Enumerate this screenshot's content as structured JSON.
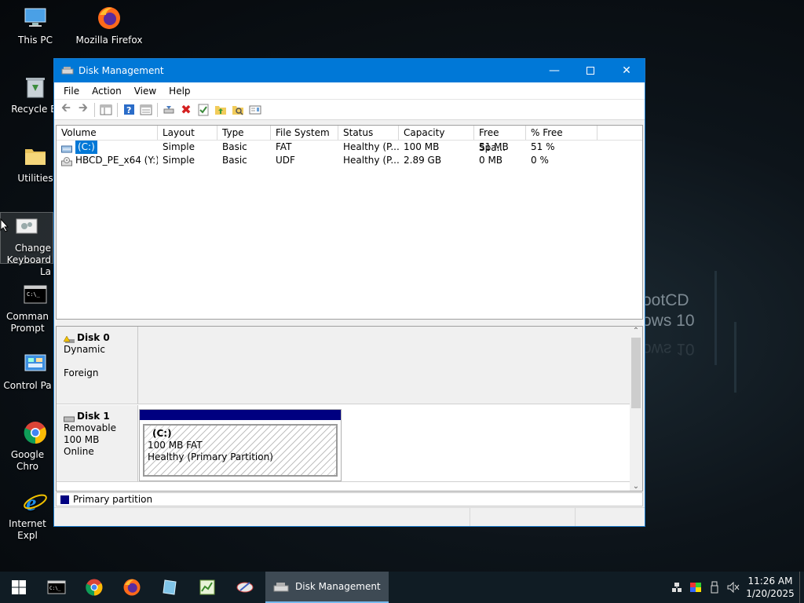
{
  "desktop": {
    "icons": [
      {
        "label": "This PC"
      },
      {
        "label": "Mozilla Firefox"
      },
      {
        "label": "Recycle Bi"
      },
      {
        "label": "Utilities"
      },
      {
        "label": "Change Keyboard La"
      },
      {
        "label": "Comman Prompt"
      },
      {
        "label": "Control Pa"
      },
      {
        "label": "Google Chro"
      },
      {
        "label": "Internet Expl"
      }
    ],
    "wallpaper_text": [
      "ootCD",
      "ows 10"
    ]
  },
  "window": {
    "title": "Disk Management",
    "menu": [
      "File",
      "Action",
      "View",
      "Help"
    ],
    "volume_list": {
      "columns": [
        "Volume",
        "Layout",
        "Type",
        "File System",
        "Status",
        "Capacity",
        "Free Spa...",
        "% Free"
      ],
      "rows": [
        {
          "volume": "(C:)",
          "layout": "Simple",
          "type": "Basic",
          "fs": "FAT",
          "status": "Healthy (P...",
          "capacity": "100 MB",
          "free": "51 MB",
          "pct": "51 %"
        },
        {
          "volume": "HBCD_PE_x64 (Y:)",
          "layout": "Simple",
          "type": "Basic",
          "fs": "UDF",
          "status": "Healthy (P...",
          "capacity": "2.89 GB",
          "free": "0 MB",
          "pct": "0 %"
        }
      ]
    },
    "disks": [
      {
        "name": "Disk 0",
        "line1": "Dynamic",
        "line2": "",
        "line3": "Foreign"
      },
      {
        "name": "Disk 1",
        "line1": "Removable",
        "line2": "100 MB",
        "line3": "Online",
        "partition": {
          "name": "(C:)",
          "size": "100 MB FAT",
          "status": "Healthy (Primary Partition)"
        }
      }
    ],
    "legend": {
      "label": "Primary partition",
      "color": "#000080"
    }
  },
  "taskbar": {
    "active_app": "Disk Management",
    "time": "11:26 AM",
    "date": "1/20/2025"
  },
  "colors": {
    "accent": "#0078d7",
    "primary_partition": "#000080"
  }
}
